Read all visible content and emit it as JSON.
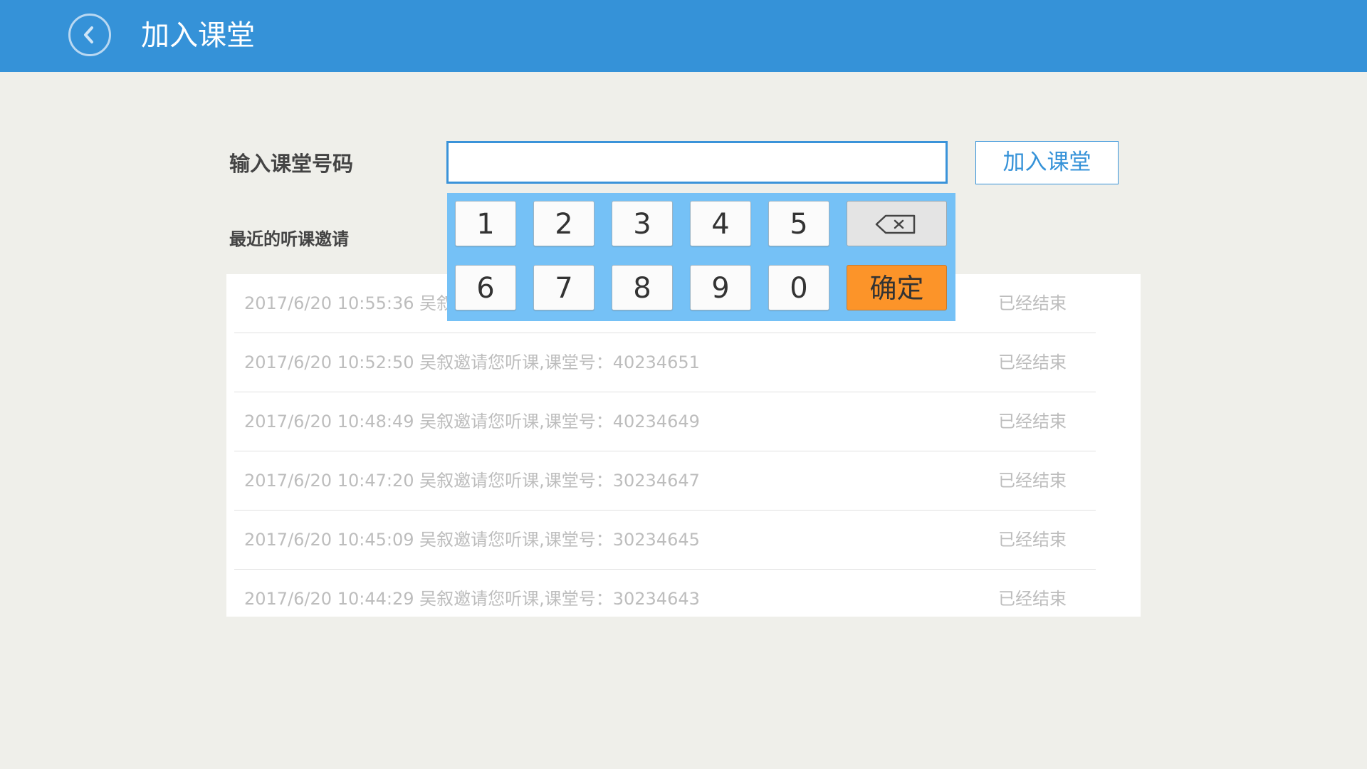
{
  "header": {
    "title": "加入课堂",
    "back_icon": "back-arrow-circle-icon"
  },
  "form": {
    "label": "输入课堂号码",
    "input_value": "",
    "join_button": "加入课堂"
  },
  "keypad": {
    "row1": [
      "1",
      "2",
      "3",
      "4",
      "5"
    ],
    "row2": [
      "6",
      "7",
      "8",
      "9",
      "0"
    ],
    "backspace_icon": "backspace-icon",
    "confirm": "确定"
  },
  "recent": {
    "title": "最近的听课邀请",
    "items": [
      {
        "text": "2017/6/20 10:55:36 吴叙邀请您听课,课堂号：40234653",
        "status": "已经结束"
      },
      {
        "text": "2017/6/20 10:52:50 吴叙邀请您听课,课堂号：40234651",
        "status": "已经结束"
      },
      {
        "text": "2017/6/20 10:48:49 吴叙邀请您听课,课堂号：40234649",
        "status": "已经结束"
      },
      {
        "text": "2017/6/20 10:47:20 吴叙邀请您听课,课堂号：30234647",
        "status": "已经结束"
      },
      {
        "text": "2017/6/20 10:45:09 吴叙邀请您听课,课堂号：30234645",
        "status": "已经结束"
      },
      {
        "text": "2017/6/20 10:44:29 吴叙邀请您听课,课堂号：30234643",
        "status": "已经结束"
      }
    ]
  },
  "colors": {
    "header_bg": "#3592d8",
    "keypad_bg": "#75c1f6",
    "confirm_bg": "#fc9429",
    "page_bg": "#efefea"
  }
}
